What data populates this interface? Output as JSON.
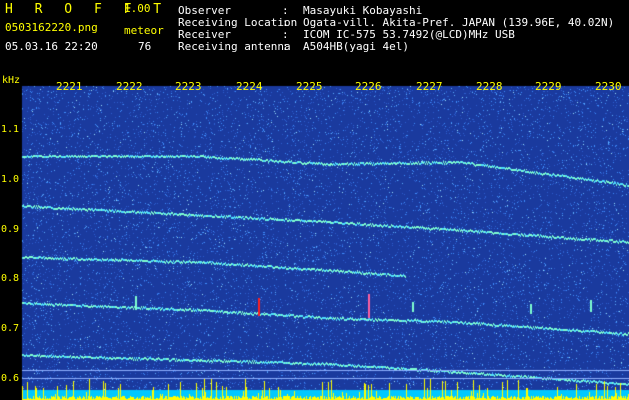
{
  "header": {
    "app_title": "H R O F F T",
    "version": "1.00",
    "filename": "0503162220.png",
    "meteor_label": "meteor",
    "datetime": "05.03.16 22:20",
    "meteor_count": "76",
    "info": [
      {
        "label": "Observer",
        "value": "Masayuki Kobayashi"
      },
      {
        "label": "Receiving Location",
        "value": "Ogata-vill. Akita-Pref. JAPAN (139.96E, 40.02N)"
      },
      {
        "label": "Receiver",
        "value": "ICOM IC-575 53.7492(@LCD)MHz USB"
      },
      {
        "label": "Receiving antenna",
        "value": "A504HB(yagi 4el)"
      }
    ]
  },
  "spectrogram": {
    "freq_unit": "kHz",
    "freq_ticks": [
      "1.1",
      "1.0",
      "0.9",
      "0.8",
      "0.7",
      "0.6"
    ],
    "time_ticks": [
      "2221",
      "2222",
      "2223",
      "2224",
      "2225",
      "2226",
      "2227",
      "2228",
      "2229",
      "2230"
    ],
    "colors": {
      "background": "#1a3a9e",
      "noise": "#3f8fff",
      "trace": "#7fffd0",
      "label": "#ffff00",
      "meteor": "#ff2020"
    }
  }
}
